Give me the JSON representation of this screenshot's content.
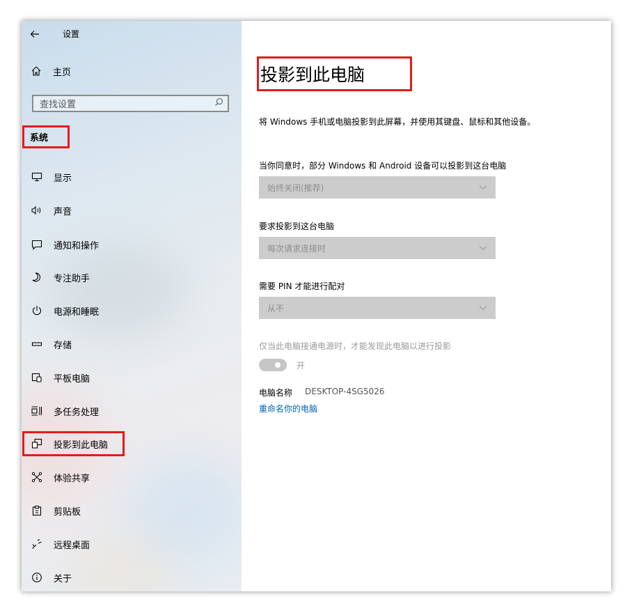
{
  "window": {
    "title": "设置"
  },
  "sidebar": {
    "home_label": "主页",
    "search_placeholder": "查找设置",
    "section_title": "系统",
    "items": [
      {
        "label": "显示",
        "icon": "monitor-icon"
      },
      {
        "label": "声音",
        "icon": "speaker-icon"
      },
      {
        "label": "通知和操作",
        "icon": "notification-icon"
      },
      {
        "label": "专注助手",
        "icon": "moon-icon"
      },
      {
        "label": "电源和睡眠",
        "icon": "power-icon"
      },
      {
        "label": "存储",
        "icon": "storage-icon"
      },
      {
        "label": "平板电脑",
        "icon": "tablet-icon"
      },
      {
        "label": "多任务处理",
        "icon": "multitask-icon"
      },
      {
        "label": "投影到此电脑",
        "icon": "project-icon",
        "active": true
      },
      {
        "label": "体验共享",
        "icon": "share-icon"
      },
      {
        "label": "剪贴板",
        "icon": "clipboard-icon"
      },
      {
        "label": "远程桌面",
        "icon": "remote-desktop-icon"
      },
      {
        "label": "关于",
        "icon": "info-icon"
      }
    ]
  },
  "main": {
    "title": "投影到此电脑",
    "description": "将 Windows 手机或电脑投影到此屏幕，并使用其键盘、鼠标和其他设备。",
    "setting1": {
      "label": "当你同意时，部分 Windows 和 Android 设备可以投影到这台电脑",
      "value": "始终关闭(推荐)"
    },
    "setting2": {
      "label": "要求投影到这台电脑",
      "value": "每次请求连接时"
    },
    "setting3": {
      "label": "需要 PIN 才能进行配对",
      "value": "从不"
    },
    "power_label": "仅当此电脑接通电源时，才能发现此电脑以进行投影",
    "toggle_label": "开",
    "pc_name_label": "电脑名称",
    "pc_name_value": "DESKTOP-4SG5026",
    "rename_link": "重命名你的电脑"
  },
  "colors": {
    "highlight": "#e31b1b",
    "link": "#0063b1",
    "dropdown_bg": "#cccccc"
  }
}
